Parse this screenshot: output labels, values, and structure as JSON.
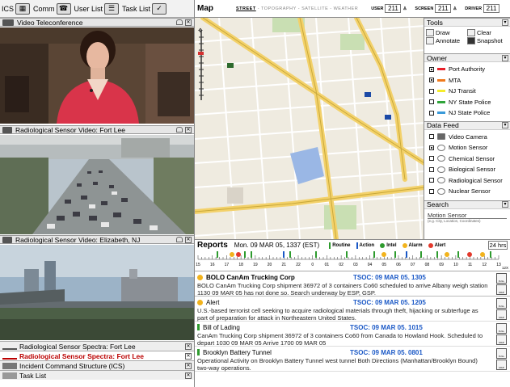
{
  "toolbar": {
    "ics_label": "ICS",
    "comm_label": "Comm",
    "userlist_label": "User List",
    "tasklist_label": "Task List"
  },
  "left_panels": {
    "video1_title": "Video Teleconference",
    "video2_title": "Radiological Sensor Video: Fort Lee",
    "video3_title": "Radiological Sensor Video: Elizabeth, NJ"
  },
  "left_lists": [
    {
      "label": "Radiological Sensor Spectra: Fort Lee",
      "highlight": false
    },
    {
      "label": "Radiological Sensor Spectra: Fort Lee",
      "highlight": true
    },
    {
      "label": "Incident Command Structure (ICS)",
      "highlight": false
    },
    {
      "label": "Task List",
      "highlight": false
    }
  ],
  "map_header": {
    "title": "Map",
    "types": [
      "STREET",
      "TOPOGRAPHY",
      "SATELLITE",
      "WEATHER"
    ],
    "selected_type": "STREET",
    "user_label": "USER",
    "user_value": "211",
    "screen_label": "SCREEN",
    "screen_value": "211",
    "driver_label": "DRIVER",
    "driver_value": "211"
  },
  "palette": {
    "tools_title": "Tools",
    "tools": [
      "Draw",
      "Clear",
      "Annotate",
      "Snapshot"
    ],
    "tools_icons": [
      "pen-icon",
      "eraser-icon",
      "abc-icon",
      "camera-icon"
    ],
    "owner_title": "Owner",
    "owners": [
      {
        "label": "Port Authority",
        "color": "#e8202a",
        "checked": true
      },
      {
        "label": "MTA",
        "color": "#f07a1c",
        "checked": true
      },
      {
        "label": "NJ Transit",
        "color": "#f5ec2b",
        "checked": false
      },
      {
        "label": "NY State Police",
        "color": "#2fa43a",
        "checked": false
      },
      {
        "label": "NJ State Police",
        "color": "#3a9ad9",
        "checked": false
      }
    ],
    "datafeed_title": "Data Feed",
    "feeds": [
      {
        "label": "Video Camera",
        "checked": false
      },
      {
        "label": "Motion Sensor",
        "checked": true
      },
      {
        "label": "Chemical Sensor",
        "checked": false
      },
      {
        "label": "Biological Sensor",
        "checked": false
      },
      {
        "label": "Radiological Sensor",
        "checked": false
      },
      {
        "label": "Nuclear Sensor",
        "checked": false
      }
    ],
    "search_title": "Search",
    "search_value": "Motion Sensor",
    "search_hint": "(e.g. City, Location, Coordinates)"
  },
  "reports_bar": {
    "title": "Reports",
    "date": "Mon. 09 MAR 05, 1337 (EST)",
    "legend": [
      {
        "label": "Routine",
        "color": "#2e9b2e",
        "kind": "bar"
      },
      {
        "label": "Action",
        "color": "#1a58c6",
        "kind": "bar"
      },
      {
        "label": "Intel",
        "color": "#2e9b2e",
        "kind": "dot"
      },
      {
        "label": "Alarm",
        "color": "#f2b31d",
        "kind": "dot"
      },
      {
        "label": "Alert",
        "color": "#e33a2d",
        "kind": "dot"
      }
    ],
    "hours": "24 hrs"
  },
  "timeline": {
    "hours": [
      "15",
      "16",
      "17",
      "18",
      "19",
      "20",
      "21",
      "22",
      "0",
      "01",
      "02",
      "03",
      "04",
      "05",
      "06",
      "07",
      "08",
      "09",
      "10",
      "11",
      "12",
      "13"
    ],
    "end_label": "12X"
  },
  "reports": [
    {
      "kind": "alarm",
      "title": "BOLO CanAm Trucking Corp",
      "bold": true,
      "time": "TSOC: 09 MAR 05. 1305",
      "body": "BOLO CanAm Trucking Corp shipment 36972 of 3 containers Co60 scheduled to arrive Albany weigh station 1130 09 MAR 05 has not done so.  Search underway by ESP, GSP."
    },
    {
      "kind": "alarm",
      "title": "Alert",
      "bold": false,
      "time": "TSOC: 09 MAR 05. 1205",
      "body": "U.S.-based terrorist cell seeking to acquire radiological materials through theft, hijacking or subterfuge as part of preparation for attack  in Northeastern United States."
    },
    {
      "kind": "routine",
      "title": "Bill of Lading",
      "bold": false,
      "time": "TSOC: 09 MAR 05. 1015",
      "body": "CanAm Trucking Corp shipment 36972 of 3 containers Co60 from Canada to Howland Hook. Scheduled to depart 1030 09 MAR 05  Arrive 1700 09 MAR 05"
    },
    {
      "kind": "routine",
      "title": "Brooklyn Battery Tunnel",
      "bold": false,
      "time": "TSOC: 09 MAR 05. 0801",
      "body": "Operational Activity on Brooklyn Battery Tunnel west tunnel Both Directions (Manhattan/Brooklyn Bound) two-way operations."
    }
  ],
  "report_actions": [
    "FULL",
    "MAP"
  ],
  "colors": {
    "alarm": "#f2b31d",
    "routine": "#2e9b2e",
    "timestamp": "#1a58c6",
    "highlight_text": "#b00000"
  }
}
